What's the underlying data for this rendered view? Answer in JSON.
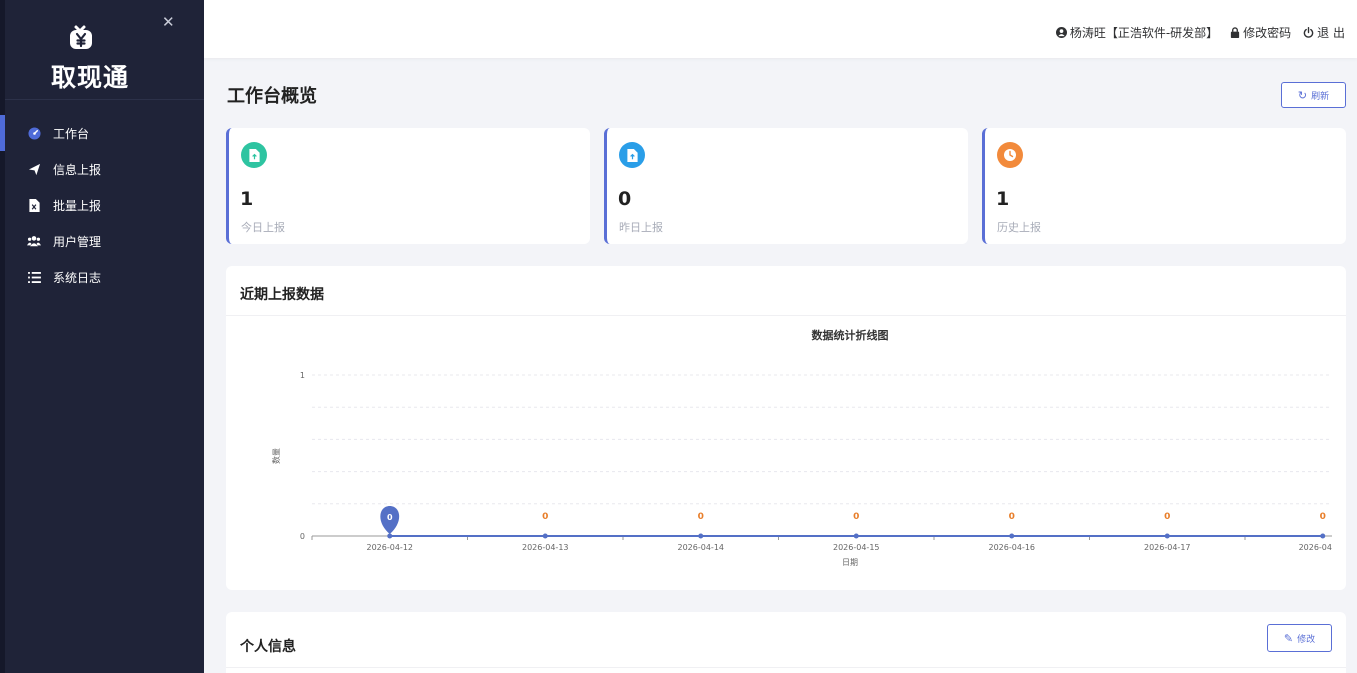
{
  "app": {
    "name": "取现通"
  },
  "sidebar": {
    "items": [
      {
        "label": "工作台",
        "icon": "dashboard-icon",
        "active": true
      },
      {
        "label": "信息上报",
        "icon": "send-icon"
      },
      {
        "label": "批量上报",
        "icon": "excel-file-icon"
      },
      {
        "label": "用户管理",
        "icon": "users-icon"
      },
      {
        "label": "系统日志",
        "icon": "list-icon"
      }
    ]
  },
  "topbar": {
    "user": "杨涛旺【正浩软件-研发部】",
    "change_password": "修改密码",
    "logout": "退 出"
  },
  "page": {
    "title": "工作台概览",
    "refresh_label": "刷新"
  },
  "stats": [
    {
      "value": "1",
      "label": "今日上报",
      "color": "#2ec4a1"
    },
    {
      "value": "0",
      "label": "昨日上报",
      "color": "#2a9ee8"
    },
    {
      "value": "1",
      "label": "历史上报",
      "color": "#f28a3b"
    }
  ],
  "chart_section": {
    "title": "近期上报数据"
  },
  "chart_data": {
    "type": "line",
    "title": "数据统计折线图",
    "xlabel": "日期",
    "ylabel": "数量",
    "categories": [
      "2026-04-12",
      "2026-04-13",
      "2026-04-14",
      "2026-04-15",
      "2026-04-16",
      "2026-04-17",
      "2026-04"
    ],
    "series": [
      {
        "values": [
          0,
          0,
          0,
          0,
          0,
          0,
          0
        ]
      }
    ],
    "ylim": [
      0,
      1
    ],
    "yticks": [
      "0",
      "1"
    ],
    "grid": true,
    "color": "#5470c6",
    "label_color": "#e87e2a"
  },
  "profile": {
    "title": "个人信息",
    "edit_label": "修改"
  }
}
